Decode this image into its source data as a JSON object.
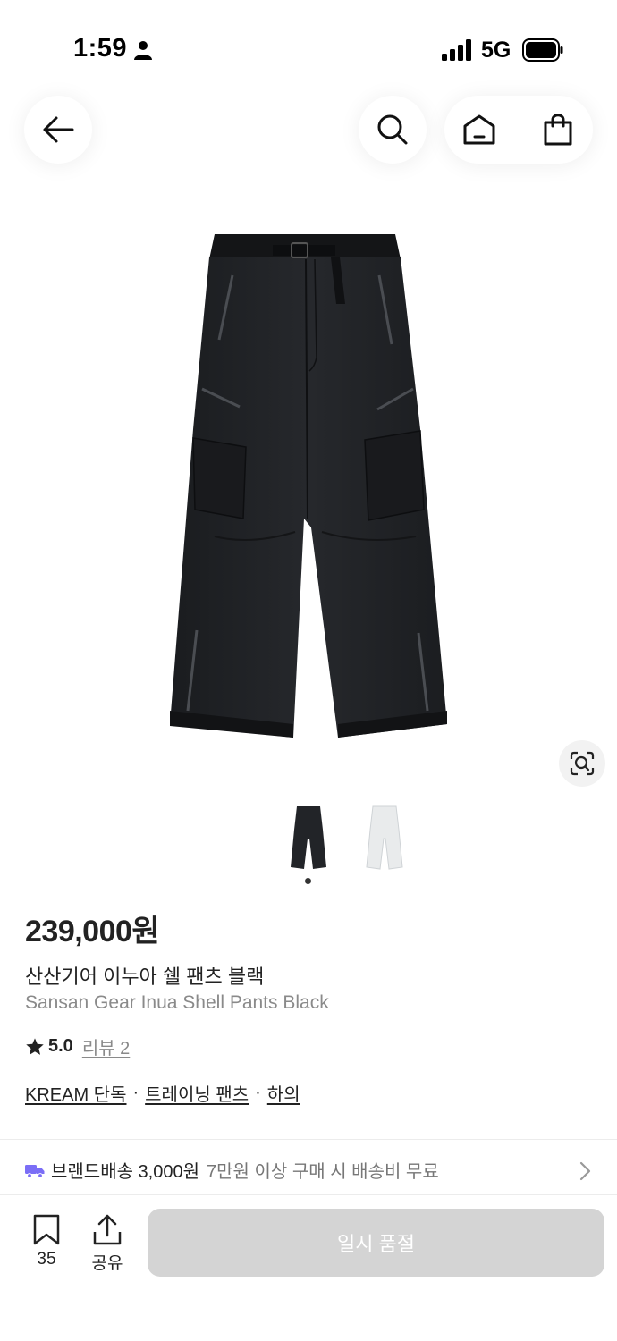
{
  "status_bar": {
    "time": "1:59",
    "network": "5G"
  },
  "product": {
    "price": "239,000원",
    "name_ko": "산산기어 이누아 쉘 팬츠 블랙",
    "name_en": "Sansan Gear Inua Shell Pants Black",
    "rating": "5.0",
    "review_label": "리뷰 2",
    "tags": [
      "KREAM 단독",
      "트레이닝 팬츠",
      "하의"
    ],
    "tag_separator": "·",
    "image_count": 2,
    "active_image": 1,
    "thumbnail_colors": [
      "black",
      "white"
    ]
  },
  "shipping": {
    "label": "브랜드배송 3,000원",
    "note": "7만원 이상 구매 시 배송비 무료"
  },
  "bottom_bar": {
    "bookmark_count": "35",
    "share_label": "공유",
    "buy_button": "일시 품절"
  },
  "icons": {
    "back": "arrow-left-icon",
    "search": "search-icon",
    "home": "home-icon",
    "bag": "shopping-bag-icon",
    "lens": "image-search-icon",
    "star": "star-icon",
    "truck": "truck-icon",
    "bookmark": "bookmark-icon",
    "share": "share-icon"
  },
  "colors": {
    "text": "#222222",
    "muted": "#8a8a8a",
    "truck": "#7b6ef6",
    "soldout_bg": "#d4d4d4"
  }
}
